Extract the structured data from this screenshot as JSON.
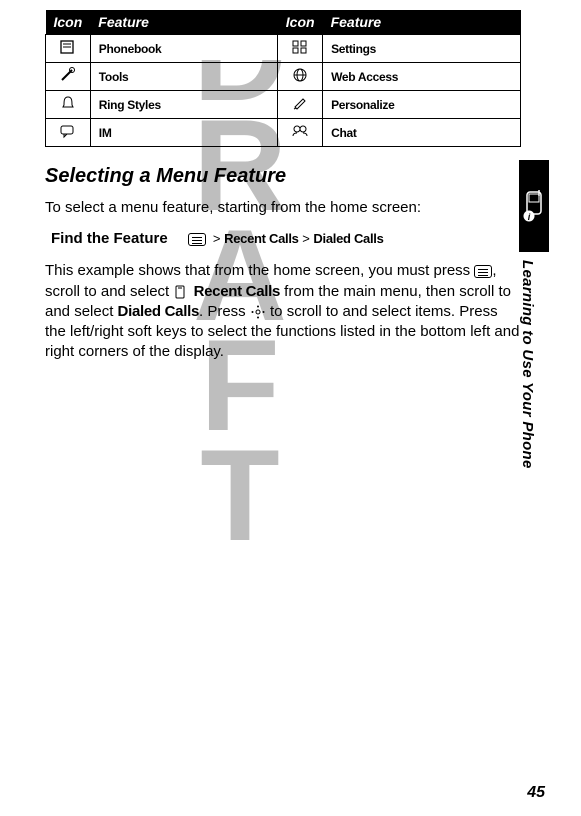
{
  "table": {
    "headers": [
      "Icon",
      "Feature",
      "Icon",
      "Feature"
    ],
    "rows": [
      {
        "f1": "Phonebook",
        "f2": "Settings"
      },
      {
        "f1": "Tools",
        "f2": "Web Access"
      },
      {
        "f1": "Ring Styles",
        "f2": "Personalize"
      },
      {
        "f1": "IM",
        "f2": "Chat"
      }
    ]
  },
  "section_title": "Selecting a Menu Feature",
  "intro_para": "To select a menu feature, starting from the home screen:",
  "find_label": "Find the Feature",
  "path": {
    "gt1": ">",
    "seg1": "Recent Calls",
    "gt2": ">",
    "seg2": "Dialed Calls"
  },
  "body2_a": "This example shows that from the home screen, you must press ",
  "body2_b": ", scroll to and select ",
  "body2_recent": "Recent Calls",
  "body2_c": " from the main menu, then scroll to and select ",
  "body2_dialed": "Dialed Calls",
  "body2_d": ". Press ",
  "body2_e": " to scroll to and select items. Press the left/right soft keys to select the functions listed in the bottom left and right corners of the display.",
  "side_text": "Learning to Use Your Phone",
  "page_number": "45"
}
